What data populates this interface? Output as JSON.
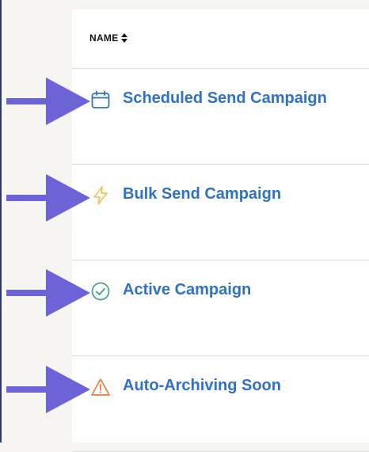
{
  "table": {
    "column_header": "NAME",
    "sort_icon": "sort-up-down-icon"
  },
  "rows": [
    {
      "label": "Scheduled Send Campaign",
      "icon": "calendar-icon",
      "icon_color": "#2f72c4"
    },
    {
      "label": "Bulk Send Campaign",
      "icon": "lightning-icon",
      "icon_color": "#f0c24b"
    },
    {
      "label": "Active Campaign",
      "icon": "check-circle-icon",
      "icon_color": "#3aa874"
    },
    {
      "label": "Auto-Archiving Soon",
      "icon": "warning-icon",
      "icon_color": "#f07a3e"
    }
  ],
  "annotation_arrow_color": "#6b63d6"
}
